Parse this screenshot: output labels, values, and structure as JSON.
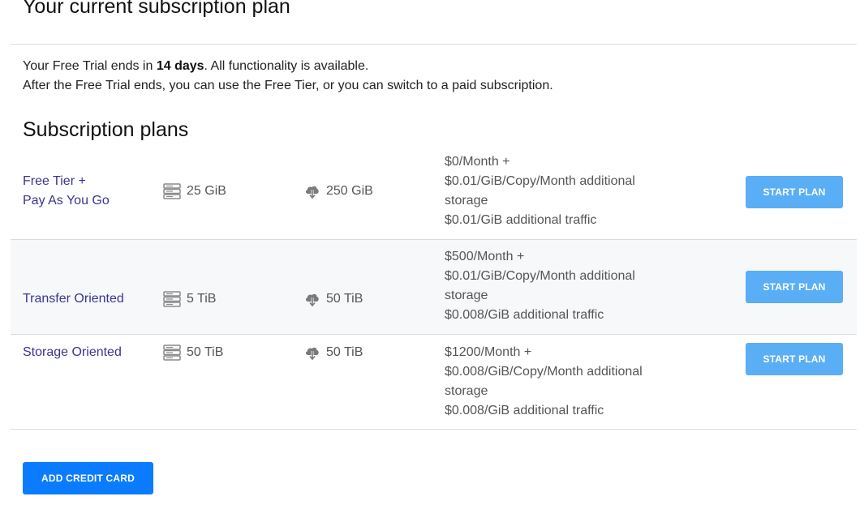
{
  "header": {
    "title": "Your current subscription plan"
  },
  "trial": {
    "prefix": "Your Free Trial ends in ",
    "days": "14 days",
    "suffix": ". All functionality is available.",
    "line2": "After the Free Trial ends, you can use the Free Tier, or you can switch to a paid subscription."
  },
  "plans_section": {
    "title": "Subscription plans",
    "button_label": "START PLAN",
    "icons": {
      "storage": "server-storage-icon",
      "traffic": "cloud-download-icon"
    },
    "items": [
      {
        "name_lines": [
          "Free Tier +",
          "Pay As You Go"
        ],
        "storage": "25 GiB",
        "traffic": "250 GiB",
        "price_lines": [
          "$0/Month +",
          "$0.01/GiB/Copy/Month additional",
          "storage",
          "$0.01/GiB additional traffic"
        ]
      },
      {
        "name_lines": [
          "Transfer Oriented"
        ],
        "storage": "5 TiB",
        "traffic": "50 TiB",
        "price_lines": [
          "$500/Month +",
          "$0.01/GiB/Copy/Month additional",
          "storage",
          "$0.008/GiB additional traffic"
        ]
      },
      {
        "name_lines": [
          "Storage Oriented"
        ],
        "storage": "50 TiB",
        "traffic": "50 TiB",
        "price_lines": [
          "$1200/Month +",
          "$0.008/GiB/Copy/Month additional",
          "storage",
          "$0.008/GiB additional traffic"
        ]
      }
    ]
  },
  "footer": {
    "add_card_label": "ADD CREDIT CARD"
  },
  "colors": {
    "plan_name": "#3b3491",
    "start_button": "#5aaef5",
    "add_card_button": "#0b7cff",
    "alt_row_bg": "#f7f8fa"
  }
}
